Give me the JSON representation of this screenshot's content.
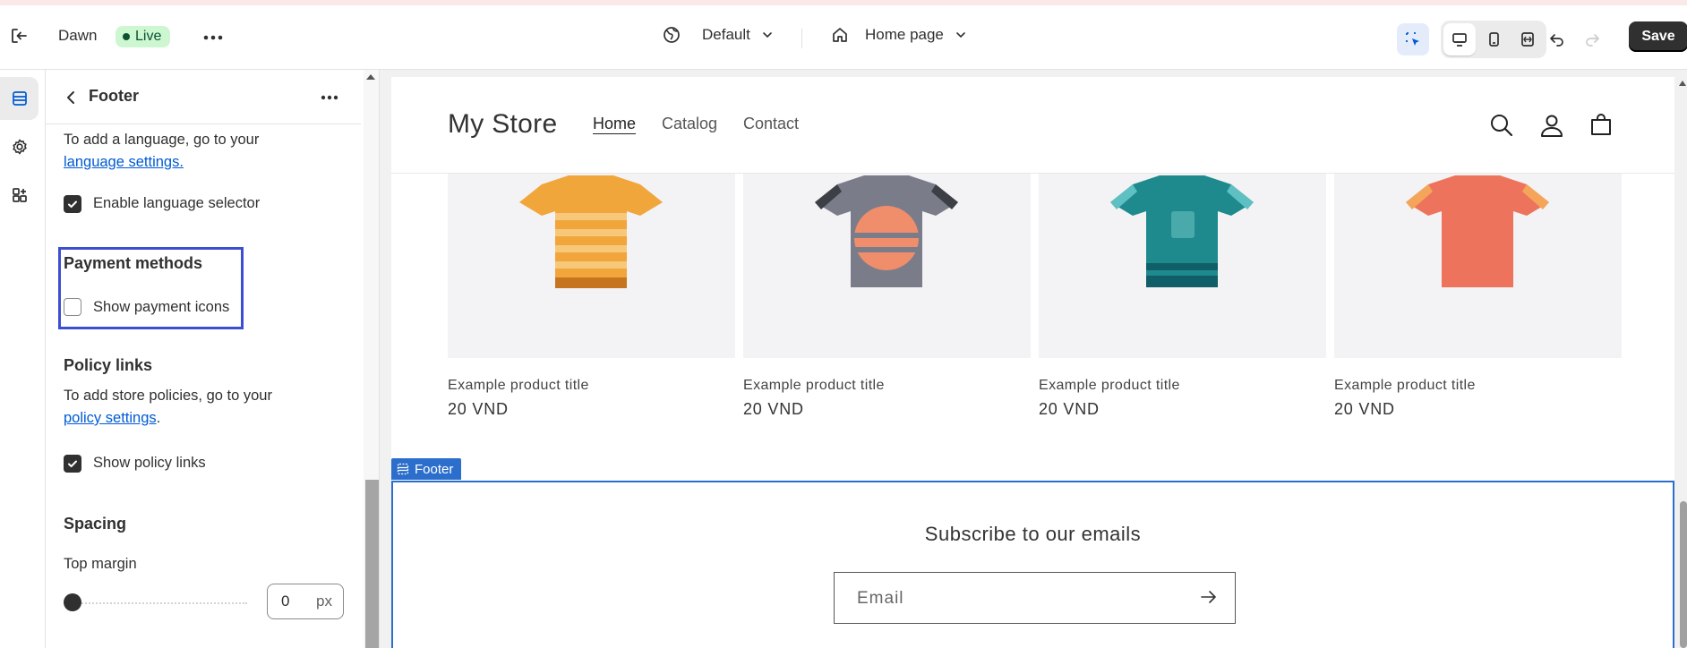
{
  "topbar": {
    "theme_name": "Dawn",
    "live_badge": "Live",
    "locale": "Default",
    "page_selector": "Home page",
    "save_label": "Save"
  },
  "panel": {
    "title": "Footer",
    "language_help": "To add a language, go to your",
    "language_link": "language settings.",
    "enable_language_label": "Enable language selector",
    "enable_language_checked": true,
    "payment_heading": "Payment methods",
    "show_payment_label": "Show payment icons",
    "show_payment_checked": false,
    "policy_heading": "Policy links",
    "policy_help": "To add store policies, go to your",
    "policy_link": "policy settings",
    "policy_link_suffix": ".",
    "show_policy_label": "Show policy links",
    "show_policy_checked": true,
    "spacing_heading": "Spacing",
    "top_margin_label": "Top margin",
    "top_margin_value": "0",
    "top_margin_unit": "px"
  },
  "store": {
    "logo": "My Store",
    "nav": [
      "Home",
      "Catalog",
      "Contact"
    ],
    "products": [
      {
        "title": "Example product title",
        "price": "20 VND",
        "color": "#f0a63a"
      },
      {
        "title": "Example product title",
        "price": "20 VND",
        "color": "#7a7d89"
      },
      {
        "title": "Example product title",
        "price": "20 VND",
        "color": "#1e8a8e"
      },
      {
        "title": "Example product title",
        "price": "20 VND",
        "color": "#ee735c"
      }
    ],
    "footer_tag": "Footer",
    "subscribe_heading": "Subscribe to our emails",
    "email_placeholder": "Email"
  },
  "colors": {
    "accent": "#2c6ecb",
    "highlight": "#3c4fd0",
    "live_bg": "#cdf7d0"
  }
}
